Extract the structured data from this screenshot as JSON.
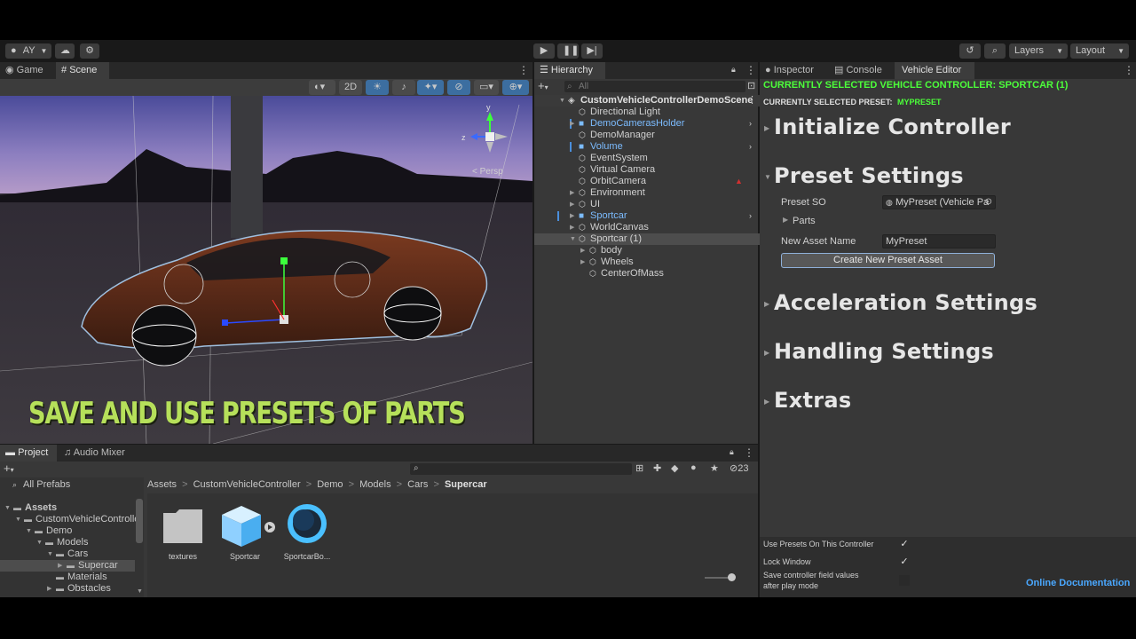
{
  "toolbar": {
    "account": "AY",
    "layers_label": "Layers",
    "layout_label": "Layout"
  },
  "game_scene": {
    "tabs": [
      {
        "label": "Game"
      },
      {
        "label": "Scene"
      }
    ],
    "view_2d": "2D",
    "gizmo_label": "< Persp",
    "overlay_caption": "SAVE AND USE PRESETS OF PARTS"
  },
  "hierarchy": {
    "tab_label": "Hierarchy",
    "search_placeholder": "All",
    "scene_name": "CustomVehicleControllerDemoScene",
    "items": [
      {
        "label": "Directional Light"
      },
      {
        "label": "DemoCamerasHolder"
      },
      {
        "label": "DemoManager"
      },
      {
        "label": "Volume"
      },
      {
        "label": "EventSystem"
      },
      {
        "label": "Virtual Camera"
      },
      {
        "label": "OrbitCamera"
      },
      {
        "label": "Environment"
      },
      {
        "label": "UI"
      },
      {
        "label": "Sportcar"
      },
      {
        "label": "WorldCanvas"
      },
      {
        "label": "Sportcar (1)"
      },
      {
        "label": "body"
      },
      {
        "label": "Wheels"
      },
      {
        "label": "CenterOfMass"
      }
    ]
  },
  "right_tabs": [
    {
      "label": "Inspector"
    },
    {
      "label": "Console"
    },
    {
      "label": "Vehicle Editor"
    }
  ],
  "vehicle_editor": {
    "selected_controller_label": "CURRENTLY SELECTED VEHICLE CONTROLLER: SPORTCAR (1)",
    "selected_preset_label": "CURRENTLY SELECTED PRESET:",
    "selected_preset_value": "MYPRESET",
    "sections": {
      "initialize": "Initialize Controller",
      "preset": "Preset  Settings",
      "acceleration": "Acceleration Settings",
      "handling": "Handling Settings",
      "extras": "Extras"
    },
    "preset_so_label": "Preset SO",
    "preset_so_value": "MyPreset (Vehicle Pa",
    "parts_label": "Parts",
    "new_asset_name_label": "New Asset Name",
    "new_asset_name_value": "MyPreset",
    "create_button": "Create New Preset Asset",
    "footer": {
      "use_presets_label": "Use Presets On This Controller",
      "lock_window_label": "Lock Window",
      "save_fields_label_1": "Save controller field values",
      "save_fields_label_2": "after play mode",
      "online_docs": "Online Documentation",
      "check_mark": "✓"
    }
  },
  "project": {
    "tabs": [
      {
        "label": "Project"
      },
      {
        "label": "Audio Mixer"
      }
    ],
    "hidden_count": "23",
    "tree": [
      {
        "label": "All Prefabs"
      },
      {
        "label": "Assets"
      },
      {
        "label": "CustomVehicleControlle"
      },
      {
        "label": "Demo"
      },
      {
        "label": "Models"
      },
      {
        "label": "Cars"
      },
      {
        "label": "Supercar"
      },
      {
        "label": "Materials"
      },
      {
        "label": "Obstacles"
      }
    ],
    "breadcrumb": [
      {
        "label": "Assets"
      },
      {
        "label": "CustomVehicleController"
      },
      {
        "label": "Demo"
      },
      {
        "label": "Models"
      },
      {
        "label": "Cars"
      },
      {
        "label": "Supercar"
      }
    ],
    "breadcrumb_sep": ">",
    "assets": [
      {
        "label": "textures"
      },
      {
        "label": "Sportcar"
      },
      {
        "label": "SportcarBo..."
      }
    ]
  },
  "colors": {
    "accent_green": "#4cff3a",
    "selection_blue": "#7cbcff",
    "caption_green": "#b6e05a"
  }
}
